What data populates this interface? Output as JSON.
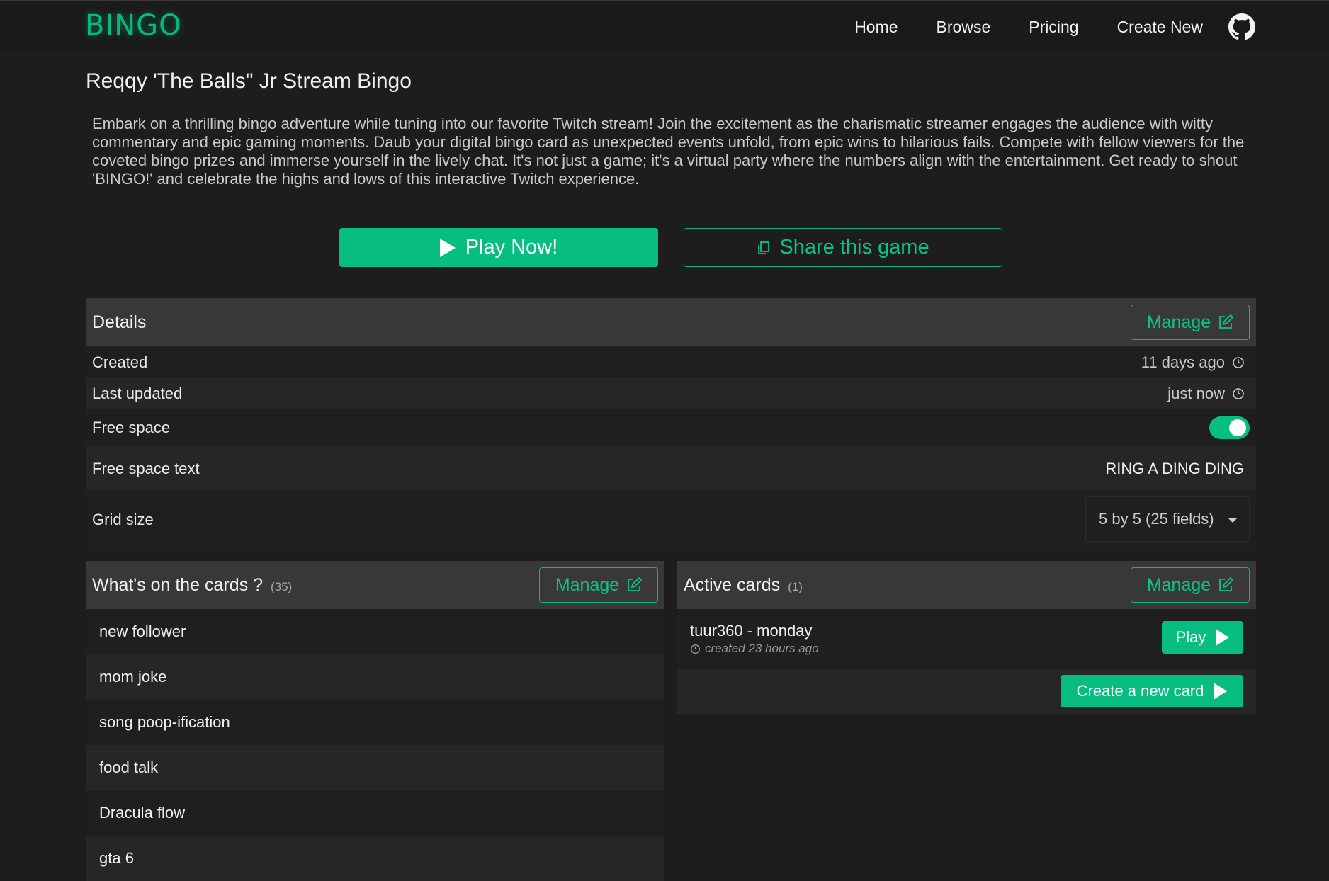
{
  "nav": {
    "logo": "BINGO",
    "links": [
      "Home",
      "Browse",
      "Pricing",
      "Create New"
    ],
    "github_icon": "github-icon"
  },
  "game": {
    "title": "Reqqy 'The Balls\" Jr Stream Bingo",
    "description": "Embark on a thrilling bingo adventure while tuning into our favorite Twitch stream! Join the excitement as the charismatic streamer engages the audience with witty commentary and epic gaming moments. Daub your digital bingo card as unexpected events unfold, from epic wins to hilarious fails. Compete with fellow viewers for the coveted bingo prizes and immerse yourself in the lively chat. It's not just a game; it's a virtual party where the numbers align with the entertainment. Get ready to shout 'BINGO!' and celebrate the highs and lows of this interactive Twitch experience.",
    "play_label": "Play Now!",
    "share_label": "Share this game"
  },
  "details": {
    "title": "Details",
    "manage_label": "Manage",
    "created_label": "Created",
    "created_value": "11 days ago",
    "updated_label": "Last updated",
    "updated_value": "just now",
    "free_space_label": "Free space",
    "free_space_enabled": true,
    "free_space_text_label": "Free space text",
    "free_space_text_value": "RING A DING DING",
    "grid_size_label": "Grid size",
    "grid_size_value": "5 by 5 (25 fields)"
  },
  "cards": {
    "title": "What's on the cards ?",
    "count": "(35)",
    "manage_label": "Manage",
    "items": [
      "new follower",
      "mom joke",
      "song poop-ification",
      "food talk",
      "Dracula flow",
      "gta 6"
    ]
  },
  "active": {
    "title": "Active cards",
    "count": "(1)",
    "manage_label": "Manage",
    "cards": [
      {
        "name": "tuur360 - monday",
        "created": "created 23 hours ago",
        "play_label": "Play"
      }
    ],
    "create_label": "Create a new card"
  },
  "colors": {
    "accent": "#07bd80",
    "background": "#1d1d1d",
    "panel_header": "#383838"
  }
}
